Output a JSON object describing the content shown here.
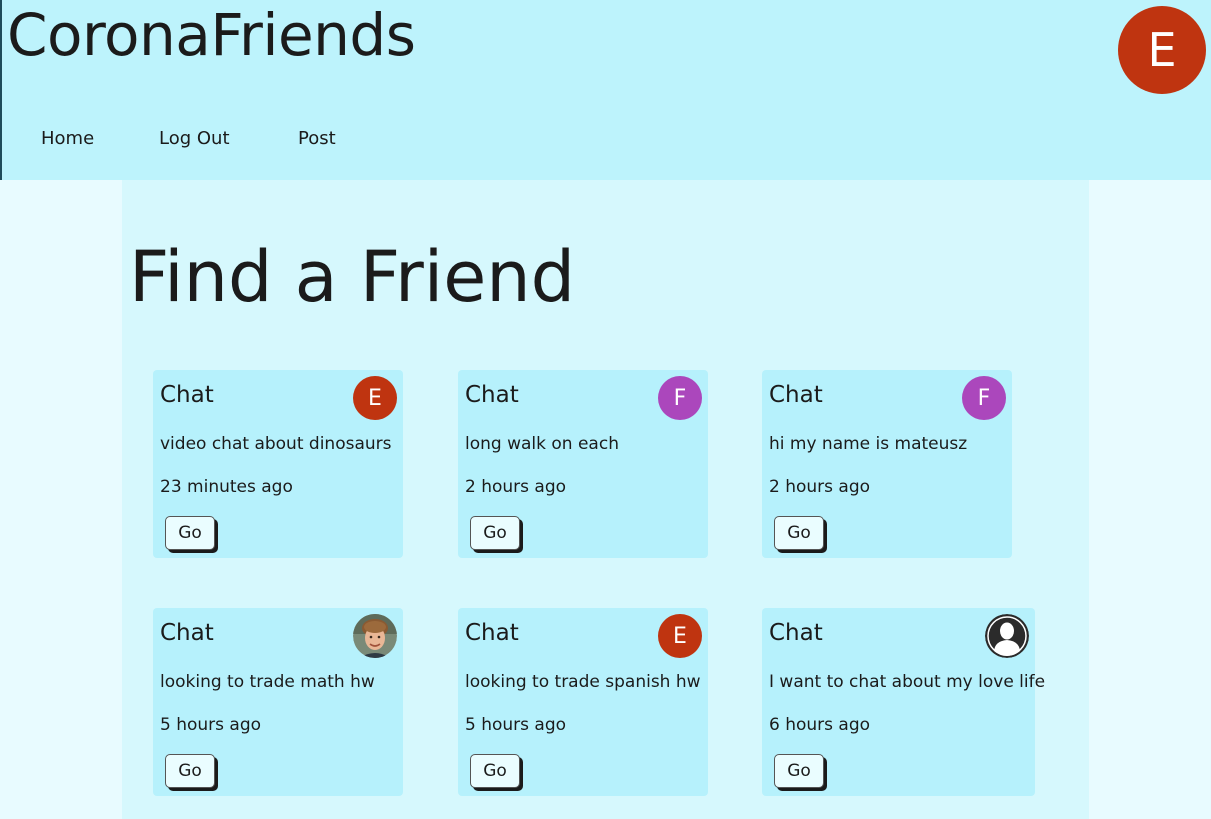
{
  "app": {
    "title": "CoronaFriends",
    "user_avatar": {
      "letter": "E",
      "color": "#bf3410"
    }
  },
  "nav": {
    "items": [
      {
        "label": "Home"
      },
      {
        "label": "Log Out"
      },
      {
        "label": "Post"
      }
    ]
  },
  "main": {
    "heading": "Find a Friend",
    "go_label": "Go",
    "cards": [
      {
        "title": "Chat",
        "avatar": {
          "type": "letter",
          "letter": "E",
          "color": "#bf3410",
          "icon": "letter-avatar-icon"
        },
        "description": "video chat about dinosaurs",
        "time": "23 minutes ago"
      },
      {
        "title": "Chat",
        "avatar": {
          "type": "letter",
          "letter": "F",
          "color": "#ab47bc",
          "icon": "letter-avatar-icon"
        },
        "description": "long walk on each",
        "time": "2 hours ago"
      },
      {
        "title": "Chat",
        "avatar": {
          "type": "letter",
          "letter": "F",
          "color": "#ab47bc",
          "icon": "letter-avatar-icon"
        },
        "description": "hi my name is mateusz",
        "time": "2 hours ago"
      },
      {
        "title": "Chat",
        "avatar": {
          "type": "photo",
          "icon": "user-photo-icon"
        },
        "description": "looking to trade math hw",
        "time": "5 hours ago"
      },
      {
        "title": "Chat",
        "avatar": {
          "type": "letter",
          "letter": "E",
          "color": "#bf3410",
          "icon": "letter-avatar-icon"
        },
        "description": "looking to trade spanish hw",
        "time": "5 hours ago"
      },
      {
        "title": "Chat",
        "avatar": {
          "type": "silhouette",
          "icon": "default-user-silhouette-icon"
        },
        "description": "I want to chat about my love life",
        "time": "6 hours ago"
      }
    ]
  }
}
